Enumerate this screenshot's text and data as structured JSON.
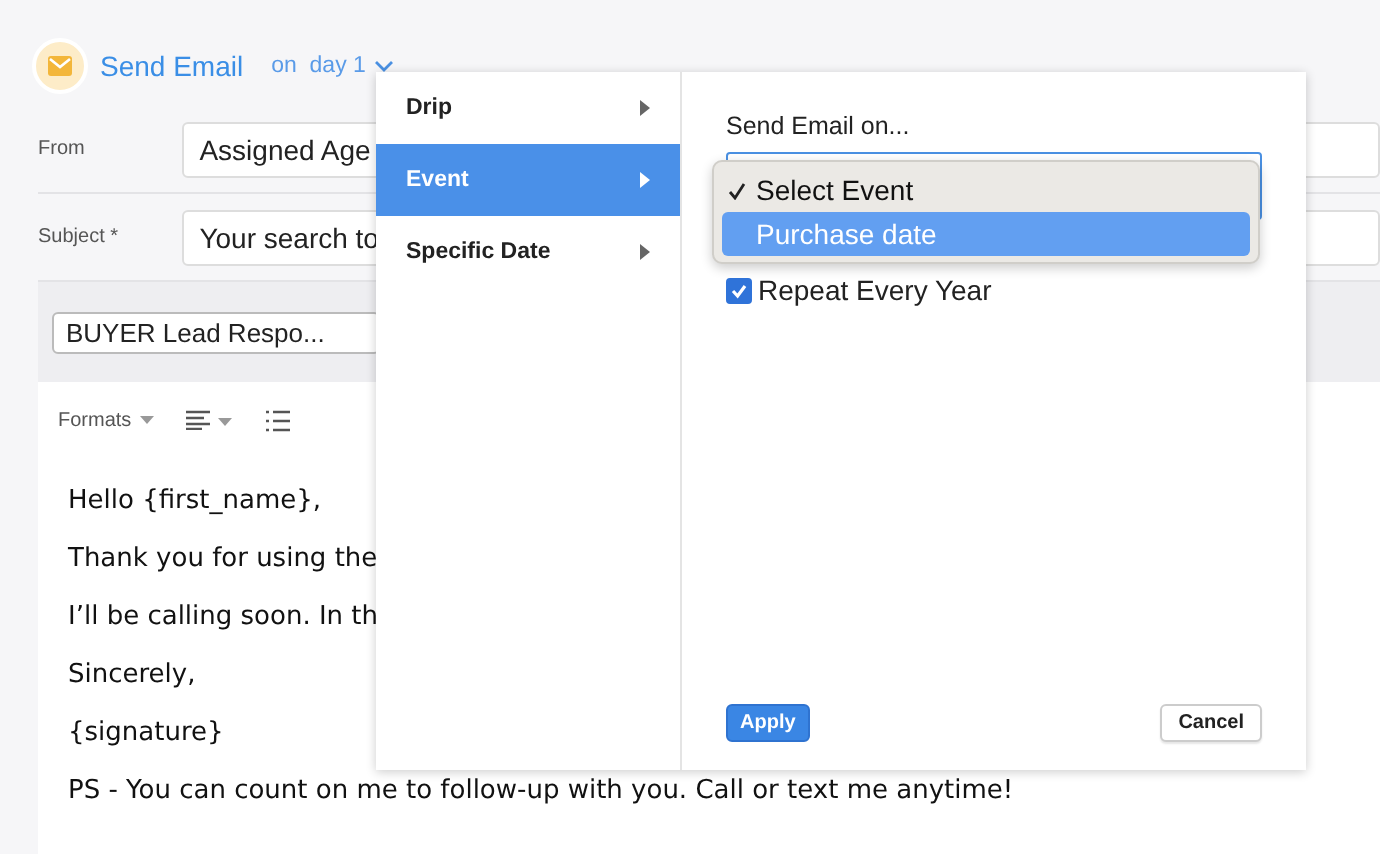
{
  "header": {
    "title": "Send Email",
    "timing": "on  day 1"
  },
  "fields": [
    {
      "label": "From",
      "value": "Assigned Age"
    },
    {
      "label": "Subject *",
      "value": "Your search to"
    }
  ],
  "template": {
    "value": "BUYER Lead Respo..."
  },
  "toolbar": {
    "formats": "Formats"
  },
  "body": [
    "Hello {first_name},",
    "Thank you for using the",
    "I’ll be calling soon. In th",
    "Sincerely,",
    "{signature}",
    "PS - You can count on me to follow-up with you. Call or text me anytime!"
  ],
  "popup": {
    "menu": [
      {
        "label": "Drip",
        "selected": false
      },
      {
        "label": "Event",
        "selected": true
      },
      {
        "label": "Specific Date",
        "selected": false
      }
    ],
    "heading": "Send Email on...",
    "options": [
      {
        "label": "Select Event",
        "checked": true,
        "selected": false
      },
      {
        "label": "Purchase date",
        "checked": false,
        "selected": true
      }
    ],
    "repeat": {
      "label": "Repeat Every Year",
      "checked": true
    },
    "apply": "Apply",
    "cancel": "Cancel"
  }
}
